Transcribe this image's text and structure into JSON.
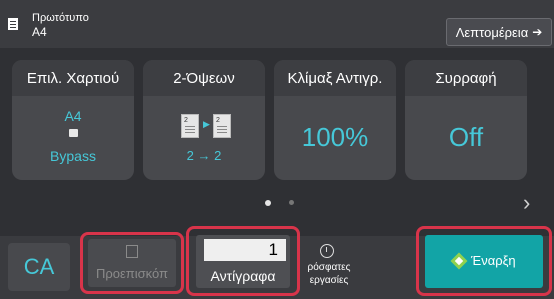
{
  "topbar": {
    "original_label": "Πρωτότυπο",
    "original_size": "A4",
    "details_label": "Λεπτομέρεια",
    "details_arrow": "➔"
  },
  "panels": [
    {
      "title": "Επιλ. Χαρτιού",
      "size": "A4",
      "tray": "Bypass"
    },
    {
      "title": "2-Όψεων",
      "mode": "2 → 2"
    },
    {
      "title": "Κλίμαξ Αντιγρ.",
      "value": "100%"
    },
    {
      "title": "Συρραφή",
      "value": "Off"
    }
  ],
  "pager": {
    "current_page": 1,
    "total_pages": 2,
    "next_chevron": "›"
  },
  "bottom": {
    "ca_label": "CA",
    "preview_label": "Προεπισκόπ",
    "copies_value": "1",
    "copies_label": "Αντίγραφα",
    "recent_line1": "ρόσφατες",
    "recent_line2": "εργασίες",
    "start_label": "Έναρξη"
  },
  "colors": {
    "accent_cyan": "#46c8d8",
    "start_teal": "#12a4a6",
    "highlight_red": "#d8344a",
    "start_icon_green": "#8fd14f"
  }
}
